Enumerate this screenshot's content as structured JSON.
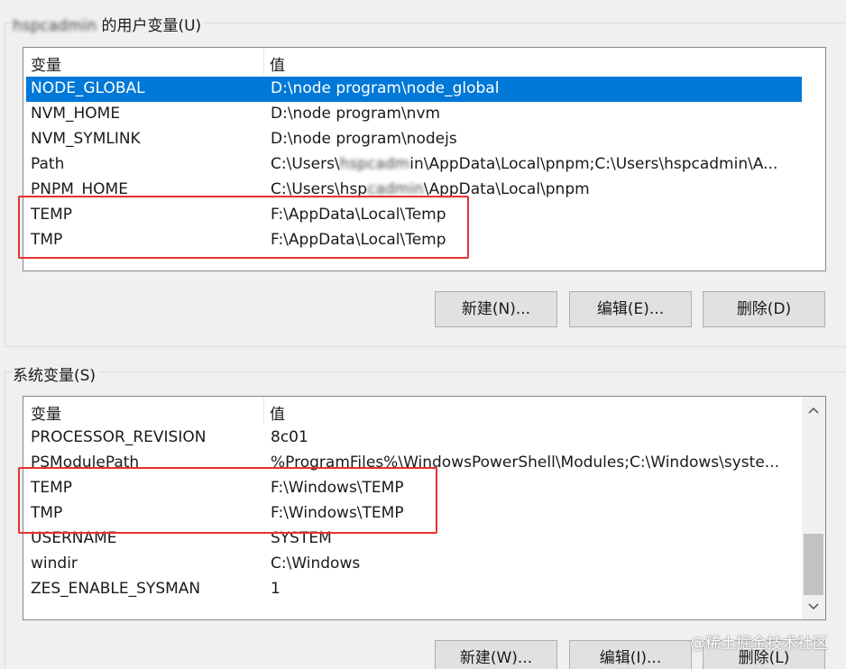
{
  "user_group": {
    "title_user_blurred": "hspcadmin",
    "title_suffix": " 的用户变量(U)",
    "header_name": "变量",
    "header_value": "值",
    "rows": [
      {
        "name": "NODE_GLOBAL",
        "value": "D:\\node program\\node_global",
        "selected": true
      },
      {
        "name": "NVM_HOME",
        "value": "D:\\node program\\nvm"
      },
      {
        "name": "NVM_SYMLINK",
        "value": "D:\\node program\\nodejs"
      },
      {
        "name": "Path",
        "value_prefix": "C:\\Users\\",
        "value_blur": "hspcadm",
        "value_suffix": "in\\AppData\\Local\\pnpm;C:\\Users\\hspcadmin\\A..."
      },
      {
        "name": "PNPM_HOME",
        "value_prefix": "C:\\Users\\hsp",
        "value_blur": "cadmin",
        "value_suffix": "\\AppData\\Local\\pnpm"
      },
      {
        "name": "TEMP",
        "value": "F:\\AppData\\Local\\Temp"
      },
      {
        "name": "TMP",
        "value": "F:\\AppData\\Local\\Temp"
      }
    ],
    "buttons": {
      "new": "新建(N)...",
      "edit": "编辑(E)...",
      "delete": "删除(D)"
    }
  },
  "system_group": {
    "title": "系统变量(S)",
    "header_name": "变量",
    "header_value": "值",
    "rows": [
      {
        "name": "PROCESSOR_REVISION",
        "value": "8c01"
      },
      {
        "name": "PSModulePath",
        "value": "%ProgramFiles%\\WindowsPowerShell\\Modules;C:\\Windows\\syste..."
      },
      {
        "name": "TEMP",
        "value": "F:\\Windows\\TEMP"
      },
      {
        "name": "TMP",
        "value": "F:\\Windows\\TEMP"
      },
      {
        "name": "USERNAME",
        "value": "SYSTEM"
      },
      {
        "name": "windir",
        "value": "C:\\Windows"
      },
      {
        "name": "ZES_ENABLE_SYSMAN",
        "value": "1"
      }
    ],
    "buttons": {
      "new": "新建(W)...",
      "edit": "编辑(I)...",
      "delete": "删除(L)"
    }
  },
  "scroll": {
    "up_icon": "chevron-up-icon",
    "down_icon": "chevron-down-icon"
  },
  "watermark": "@稀土掘金技术社区",
  "colors": {
    "selection": "#0078d7",
    "highlight_box": "#e8312f",
    "window_bg": "#f0f0f0"
  }
}
